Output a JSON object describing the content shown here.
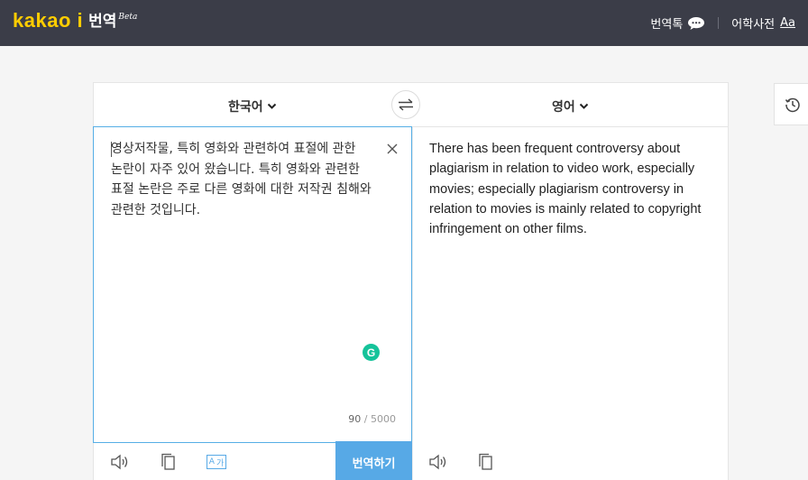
{
  "header": {
    "logo_brand": "kakao i",
    "logo_service": "번역",
    "logo_badge": "Beta",
    "nav": {
      "talk_label": "번역톡",
      "dictionary_label": "어학사전",
      "dictionary_badge": "Aa"
    }
  },
  "languages": {
    "source": "한국어",
    "target": "영어"
  },
  "source": {
    "text": "영상저작물, 특히 영화와 관련하여 표절에 관한 논란이 자주 있어 왔습니다. 특히 영화와 관련한 표절 논란은 주로 다른 영화에 대한 저작권 침해와 관련한 것입니다.",
    "char_count": "90",
    "char_limit": "/ 5000"
  },
  "target": {
    "text": "There has been frequent controversy about plagiarism in relation to video work, especially movies; especially plagiarism controversy in relation to movies is mainly related to copyright infringement on other films."
  },
  "actions": {
    "translate_label": "번역하기",
    "romanize_label_a": "A",
    "romanize_label_b": "가"
  },
  "icons": {
    "talk": "chat-bubble-icon",
    "history": "history-clock-icon",
    "swap": "swap-arrows-icon",
    "clear": "close-icon",
    "speaker": "speaker-icon",
    "copy": "copy-icon",
    "grammarly": "grammarly-icon"
  },
  "colors": {
    "topbar": "#3b3d48",
    "brand_yellow": "#ffcd00",
    "accent_blue": "#57a9e6",
    "grammarly_green": "#15c39a"
  }
}
